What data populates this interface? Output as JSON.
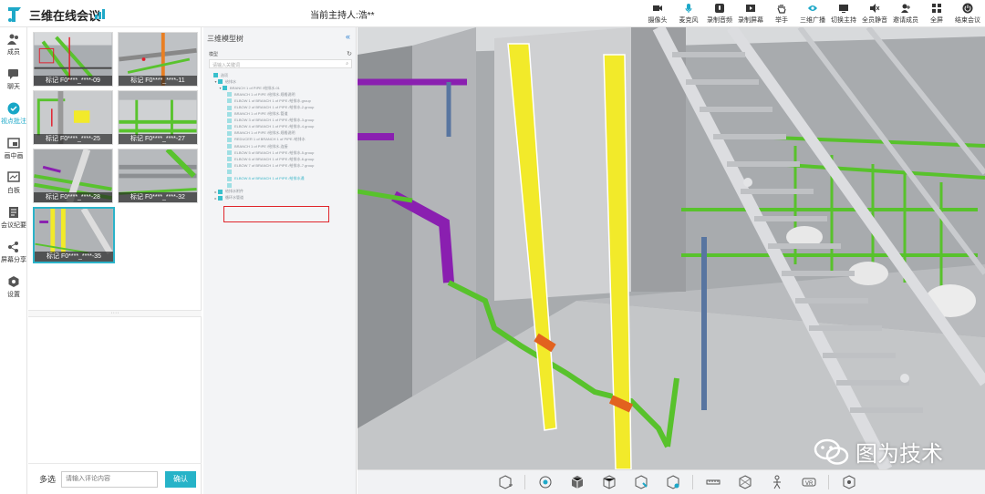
{
  "app": {
    "title": "三维在线会议",
    "host_label": "当前主持人:浩**",
    "brand_color": "#1ea8c8"
  },
  "toolbar": [
    {
      "label": "摄像头",
      "icon": "camera-icon"
    },
    {
      "label": "麦克风",
      "icon": "microphone-icon"
    },
    {
      "label": "录制音频",
      "icon": "record-audio-icon"
    },
    {
      "label": "录制屏幕",
      "icon": "record-screen-icon"
    },
    {
      "label": "举手",
      "icon": "raise-hand-icon"
    },
    {
      "label": "三维广播",
      "icon": "eye-icon"
    },
    {
      "label": "切换主持",
      "icon": "switch-host-icon"
    },
    {
      "label": "全员静音",
      "icon": "mute-all-icon"
    },
    {
      "label": "邀请成员",
      "icon": "invite-icon"
    },
    {
      "label": "全屏",
      "icon": "fullscreen-icon"
    },
    {
      "label": "结束会议",
      "icon": "power-icon"
    }
  ],
  "sidenav": [
    {
      "label": "成员",
      "icon": "members-icon"
    },
    {
      "label": "聊天",
      "icon": "chat-icon"
    },
    {
      "label": "视点批注",
      "icon": "viewpoint-icon",
      "active": true
    },
    {
      "label": "画中画",
      "icon": "picture-in-picture-icon"
    },
    {
      "label": "白板",
      "icon": "whiteboard-icon"
    },
    {
      "label": "会议纪要",
      "icon": "minutes-icon"
    },
    {
      "label": "屏幕分享",
      "icon": "share-screen-icon"
    },
    {
      "label": "设置",
      "icon": "settings-icon"
    }
  ],
  "thumbnails": [
    {
      "caption": "标记 F0****_****-09"
    },
    {
      "caption": "标记 F0****_****-11"
    },
    {
      "caption": "标记 F0****_****-25"
    },
    {
      "caption": "标记 F0****_****-27"
    },
    {
      "caption": "标记 F0****_****-28"
    },
    {
      "caption": "标记 F0****_****-32"
    },
    {
      "caption": "标记 F0****_****-35",
      "selected": true
    }
  ],
  "comment": {
    "multi_label": "多选",
    "placeholder": "请输入评论内容",
    "confirm_label": "确认"
  },
  "tree": {
    "title": "三维模型树",
    "label": "模型",
    "search_placeholder": "请输入关键词",
    "rows": [
      {
        "text": "选项",
        "level": 0,
        "toggle": ""
      },
      {
        "text": "给排水",
        "level": 1,
        "toggle": "▾"
      },
      {
        "text": "BRANCH 1 of PIPE /给排水-01",
        "level": 2,
        "toggle": "▾"
      },
      {
        "text": "BRANCH 1 of PIPE /给排水-规格说明",
        "level": 3,
        "toggle": ""
      },
      {
        "text": "ELBOW 1 of BRANCH 1 of PIPE /给排水.group",
        "level": 3,
        "toggle": ""
      },
      {
        "text": "ELBOW 2 of BRANCH 1 of PIPE /给排水-2.group",
        "level": 3,
        "toggle": ""
      },
      {
        "text": "BRANCH 1 of PIPE /给排水-管道",
        "level": 3,
        "toggle": ""
      },
      {
        "text": "ELBOW 3 of BRANCH 1 of PIPE /给排水-3.group",
        "level": 3,
        "toggle": ""
      },
      {
        "text": "ELBOW 4 of BRANCH 1 of PIPE /给排水-4.group",
        "level": 3,
        "toggle": ""
      },
      {
        "text": "BRANCH 1 of PIPE /给排水-规格说明",
        "level": 3,
        "toggle": ""
      },
      {
        "text": "REDUCER 1 of BRANCH 1 of PIPE /给排水",
        "level": 3,
        "toggle": ""
      },
      {
        "text": "BRANCH 1 of PIPE /给排水-连接",
        "level": 3,
        "toggle": ""
      },
      {
        "text": "ELBOW 5 of BRANCH 1 of PIPE /给排水-5.group",
        "level": 3,
        "toggle": ""
      },
      {
        "text": "ELBOW 6 of BRANCH 1 of PIPE /给排水-6.group",
        "level": 3,
        "toggle": ""
      },
      {
        "text": "ELBOW 7 of BRANCH 1 of PIPE /给排水-7.group",
        "level": 3,
        "toggle": ""
      },
      {
        "text": "",
        "level": 3,
        "toggle": ""
      },
      {
        "text": "ELBOW 8 of BRANCH 1 of PIPE /给排水通",
        "level": 3,
        "toggle": "",
        "highlight": true
      },
      {
        "text": "",
        "level": 3,
        "toggle": ""
      },
      {
        "text": "给排水附件",
        "level": 1,
        "toggle": "▸"
      },
      {
        "text": "循环水管道",
        "level": 1,
        "toggle": "▸"
      }
    ]
  },
  "scene_colors": {
    "yellow_column": "#f2ea2a",
    "green_pipe": "#58c22c",
    "purple_pipe": "#8a1fb0",
    "orange_band": "#e2621f",
    "wall": "#c8c8c8",
    "stair": "#b5b8bb"
  },
  "bottom_tools": [
    {
      "icon": "add-model-icon"
    },
    {
      "icon": "focus-icon"
    },
    {
      "icon": "cube-icon"
    },
    {
      "icon": "cube-view-icon"
    },
    {
      "icon": "cube-edit-icon"
    },
    {
      "icon": "cube-settings-icon"
    },
    {
      "icon": "measure-icon"
    },
    {
      "icon": "section-box-icon"
    },
    {
      "icon": "walk-icon"
    },
    {
      "icon": "vr-icon"
    },
    {
      "icon": "model-tool-icon"
    }
  ],
  "watermark": {
    "text": "图为技术"
  }
}
